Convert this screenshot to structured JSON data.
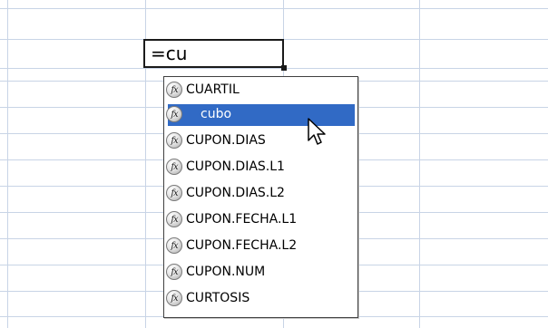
{
  "sheet": {
    "gridColor": "#c8d4e6"
  },
  "editor": {
    "formula": "=cu"
  },
  "autocomplete": {
    "selectedColor": "#316ac5",
    "items": [
      {
        "label": "CUARTIL",
        "icon": "function-icon"
      },
      {
        "label": "cubo",
        "icon": "function-icon",
        "selected": true
      },
      {
        "label": "CUPON.DIAS",
        "icon": "function-icon"
      },
      {
        "label": "CUPON.DIAS.L1",
        "icon": "function-icon"
      },
      {
        "label": "CUPON.DIAS.L2",
        "icon": "function-icon"
      },
      {
        "label": "CUPON.FECHA.L1",
        "icon": "function-icon"
      },
      {
        "label": "CUPON.FECHA.L2",
        "icon": "function-icon"
      },
      {
        "label": "CUPON.NUM",
        "icon": "function-icon"
      },
      {
        "label": "CURTOSIS",
        "icon": "function-icon"
      }
    ]
  }
}
